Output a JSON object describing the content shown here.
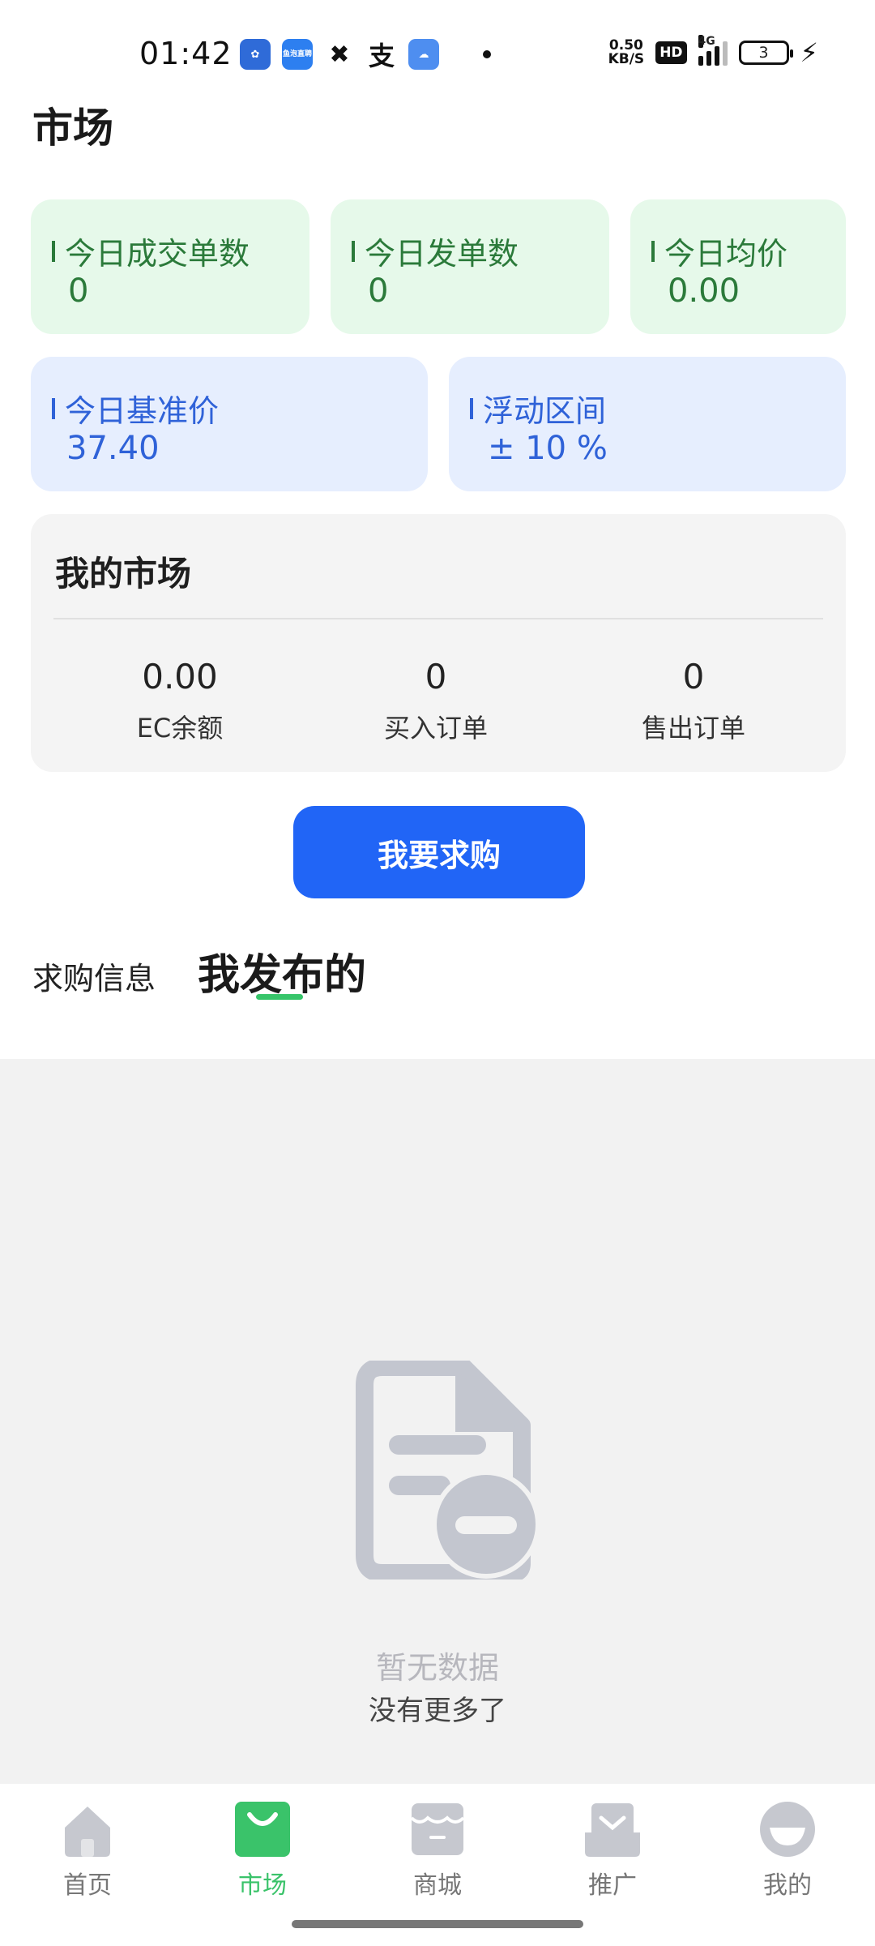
{
  "status_bar": {
    "time": "01:42",
    "net_speed_value": "0.50",
    "net_speed_unit": "KB/S",
    "hd_label": "HD",
    "network_type": "4G",
    "battery_level": "3",
    "app_icons": [
      "baidu-icon",
      "yupao-icon",
      "grid-app-icon",
      "alipay-icon",
      "weather-icon"
    ],
    "app_icon_texts": [
      "",
      "鱼泡直聘"
    ]
  },
  "page": {
    "title": "市场"
  },
  "stats_top": [
    {
      "label": "今日成交单数",
      "value": "0"
    },
    {
      "label": "今日发单数",
      "value": "0"
    },
    {
      "label": "今日均价",
      "value": "0.00"
    }
  ],
  "stats_mid": [
    {
      "label": "今日基准价",
      "value": "37.40"
    },
    {
      "label": "浮动区间",
      "value": "± 10 %"
    }
  ],
  "my_market": {
    "title": "我的市场",
    "balance_value": "0.00",
    "balance_label": "EC余额",
    "buy_orders_value": "0",
    "buy_orders_label": "买入订单",
    "sell_orders_value": "0",
    "sell_orders_label": "售出订单"
  },
  "buy_button": {
    "label": "我要求购"
  },
  "tabs": [
    {
      "label": "求购信息",
      "active": false
    },
    {
      "label": "我发布的",
      "active": true
    }
  ],
  "empty_state": {
    "title": "暂无数据",
    "subtitle": "没有更多了"
  },
  "bottom_nav": [
    {
      "label": "首页",
      "icon": "home-icon",
      "active": false
    },
    {
      "label": "市场",
      "icon": "shopping-bag-icon",
      "active": true
    },
    {
      "label": "商城",
      "icon": "store-icon",
      "active": false
    },
    {
      "label": "推广",
      "icon": "mail-tray-icon",
      "active": false
    },
    {
      "label": "我的",
      "icon": "profile-icon",
      "active": false
    }
  ],
  "colors": {
    "accent_green": "#3ac36a",
    "primary_blue": "#2165f6",
    "green_card_bg": "#e6f9ea",
    "blue_card_bg": "#e6eefe",
    "green_text": "#2b7a3a",
    "blue_text": "#2f62d8"
  }
}
